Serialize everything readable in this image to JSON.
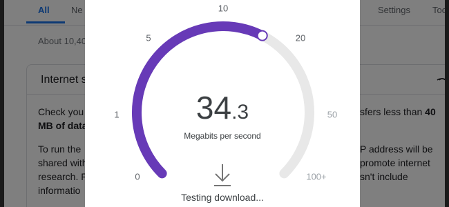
{
  "background": {
    "tabs": {
      "all": "All",
      "news_partial": "Ne",
      "settings": "Settings",
      "tools_partial": "Too"
    },
    "result_count_partial": "About 10,40",
    "card": {
      "title_partial": "Internet s",
      "lines_left": [
        "Check you",
        "MB of data",
        "To run the",
        "shared with",
        "research. F",
        "informatio"
      ],
      "lines_right": [
        "sfers less than ",
        "40",
        "P address will be",
        "promote internet",
        "sn't include"
      ],
      "menu_icon": "more-options-icon"
    }
  },
  "speed_test": {
    "gauge": {
      "scale_labels": [
        "0",
        "1",
        "5",
        "10",
        "20",
        "50",
        "100+"
      ],
      "progress_fraction": 0.6,
      "colors": {
        "progress": "#673ab7",
        "track": "#e8e8e8",
        "marker": "#ffffff"
      }
    },
    "speed_integer": "34",
    "speed_decimal": ".3",
    "unit": "Megabits per second",
    "status": "Testing download...",
    "status_icon": "download-icon"
  }
}
